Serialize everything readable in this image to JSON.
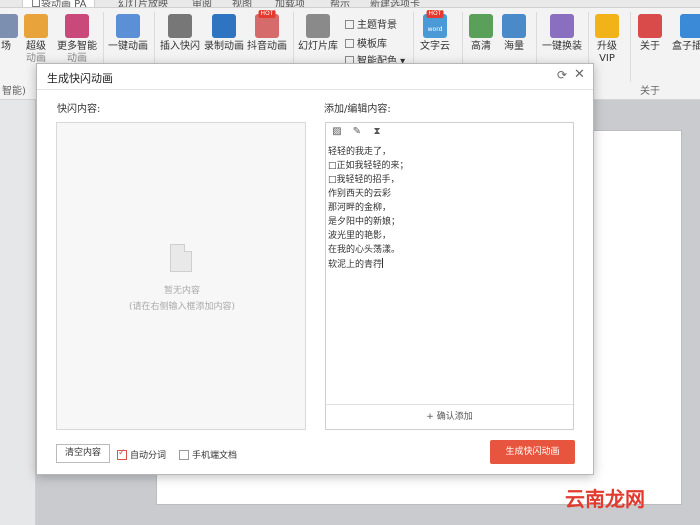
{
  "ribbon": {
    "tabs": [
      "口袋动画 PA",
      "幻灯片放映",
      "审阅",
      "视图",
      "加载项",
      "帮示",
      "新建选项卡"
    ],
    "buttons": [
      {
        "label": "场",
        "color": "#7c8fb0"
      },
      {
        "label": "超级",
        "sub": "动画",
        "color": "#e8a33b"
      },
      {
        "label": "更多智能",
        "sub": "动画",
        "color": "#c94a7a"
      },
      {
        "label": "一键动画",
        "color": "#5b8fd6"
      },
      {
        "label": "插入快闪",
        "color": "#777777"
      },
      {
        "label": "录制动画",
        "color": "#2f74c0"
      },
      {
        "label": "抖音动画",
        "hot": "HOT",
        "color": "#d66b6b"
      },
      {
        "label": "幻灯片库",
        "color": "#8a8a8a"
      },
      {
        "label": "文字云",
        "hot": "HOT",
        "sub": "word",
        "color": "#4a9ad8"
      },
      {
        "label": "高清",
        "color": "#5aa05a"
      },
      {
        "label": "海量",
        "color": "#4a8ac8"
      },
      {
        "label": "一键换装",
        "color": "#8a6fc0"
      },
      {
        "label": "升级",
        "sub": "VIP",
        "color": "#f2b319"
      },
      {
        "label": "关于",
        "color": "#d94a4a"
      },
      {
        "label": "盒子插件",
        "color": "#3b8ad8"
      }
    ],
    "small_items": [
      "主题背景",
      "模板库",
      "智能配色"
    ],
    "group_labels": [
      "智能)",
      "关于"
    ]
  },
  "dialog": {
    "title": "生成快闪动画",
    "left_label": "快闪内容:",
    "right_label": "添加/编辑内容:",
    "empty_title": "暂无内容",
    "empty_hint": "(请在右侧输入框添加内容)",
    "editor_lines": [
      "轻轻的我走了，",
      "□正如我轻轻的来；",
      "□我轻轻的招手，",
      "作别西天的云彩",
      " 那河畔的金柳，",
      "是夕阳中的新娘；",
      "波光里的艳影，",
      "在我的心头荡漾。",
      "软泥上的青荇"
    ],
    "add_button": "+ 确认添加",
    "clear_button": "清空内容",
    "auto_split": "自动分词",
    "auto_split_checked": true,
    "mobile_doc": "手机端文档",
    "mobile_doc_checked": false,
    "generate_button": "生成快闪动画"
  },
  "watermark": "云南龙网",
  "colors": {
    "accent": "#e8553e"
  }
}
